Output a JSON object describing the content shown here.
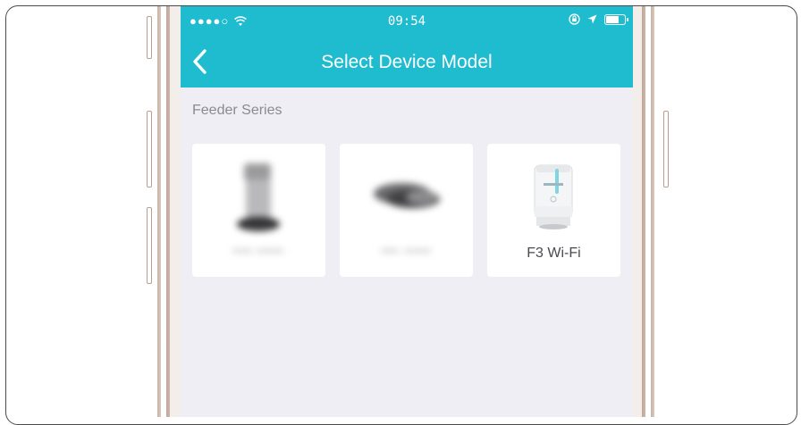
{
  "status_bar": {
    "signal": "●●●●○",
    "time": "09:54"
  },
  "nav": {
    "title": "Select Device Model"
  },
  "section": {
    "label": "Feeder Series"
  },
  "devices": [
    {
      "label": "",
      "icon": "feeder-blurred-icon"
    },
    {
      "label": "",
      "icon": "feeder-bowl-blurred-icon"
    },
    {
      "label": "F3 Wi-Fi",
      "icon": "f3-feeder-icon"
    }
  ],
  "colors": {
    "accent": "#1fbcd0",
    "background": "#eeeef4",
    "card": "#ffffff"
  }
}
